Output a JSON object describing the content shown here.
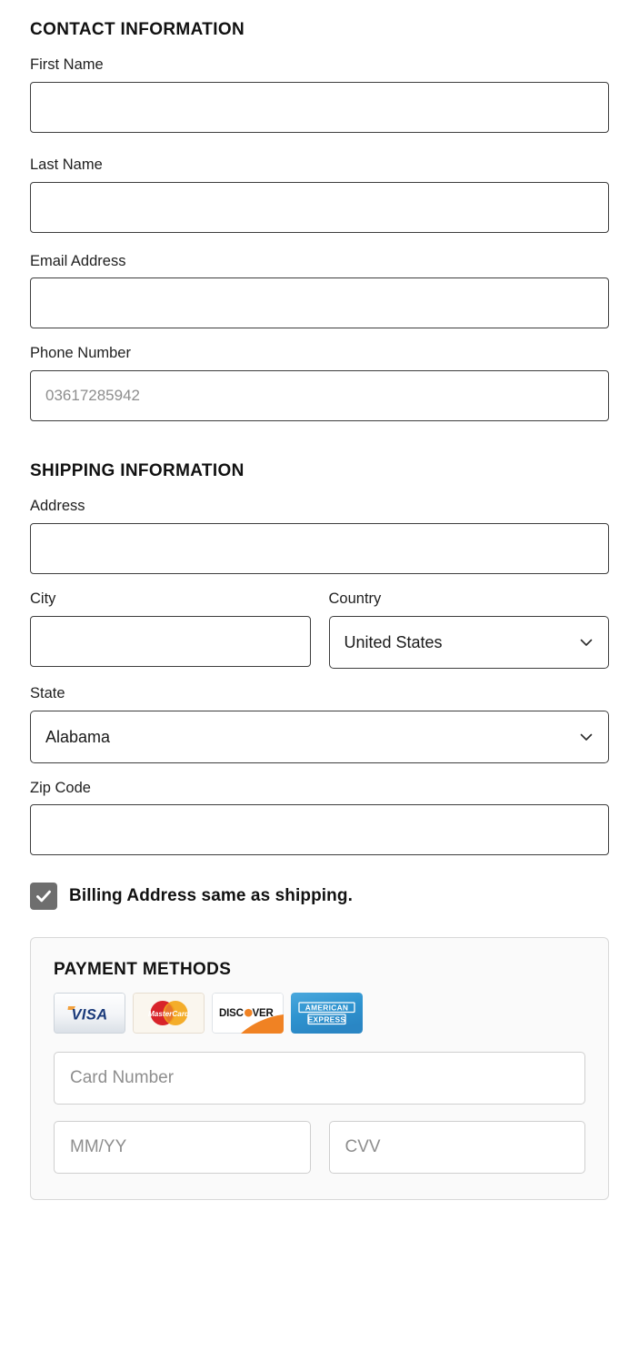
{
  "contact": {
    "heading": "CONTACT INFORMATION",
    "fields": [
      {
        "label": "First Name",
        "value": "",
        "placeholder": ""
      },
      {
        "label": "Last Name",
        "value": "",
        "placeholder": ""
      },
      {
        "label": "Email Address",
        "value": "",
        "placeholder": ""
      },
      {
        "label": "Phone Number",
        "value": "",
        "placeholder": "03617285942"
      }
    ]
  },
  "shipping": {
    "heading": "SHIPPING INFORMATION",
    "address": {
      "label": "Address",
      "value": "",
      "placeholder": ""
    },
    "city": {
      "label": "City",
      "value": "",
      "placeholder": ""
    },
    "country": {
      "label": "Country",
      "selected": "United States"
    },
    "state": {
      "label": "State",
      "selected": "Alabama"
    },
    "zip": {
      "label": "Zip Code",
      "value": "",
      "placeholder": ""
    }
  },
  "billing": {
    "checkbox_label": "Billing Address same as shipping.",
    "checked": true,
    "checkbox_color": "#6e6e6e"
  },
  "payment": {
    "heading": "PAYMENT METHODS",
    "cards": [
      {
        "name": "visa-logo",
        "label": "VISA"
      },
      {
        "name": "mastercard-logo",
        "label": "MasterCard"
      },
      {
        "name": "discover-logo",
        "label": "DISCOVER"
      },
      {
        "name": "american-express-logo",
        "label": "AMERICAN EXPRESS"
      }
    ],
    "card_number": {
      "placeholder": "Card Number",
      "value": ""
    },
    "expiry": {
      "placeholder": "MM/YY",
      "value": ""
    },
    "cvv": {
      "placeholder": "CVV",
      "value": ""
    }
  },
  "icons": {
    "chevron_down": "chevron-down-icon",
    "check": "check-icon"
  }
}
